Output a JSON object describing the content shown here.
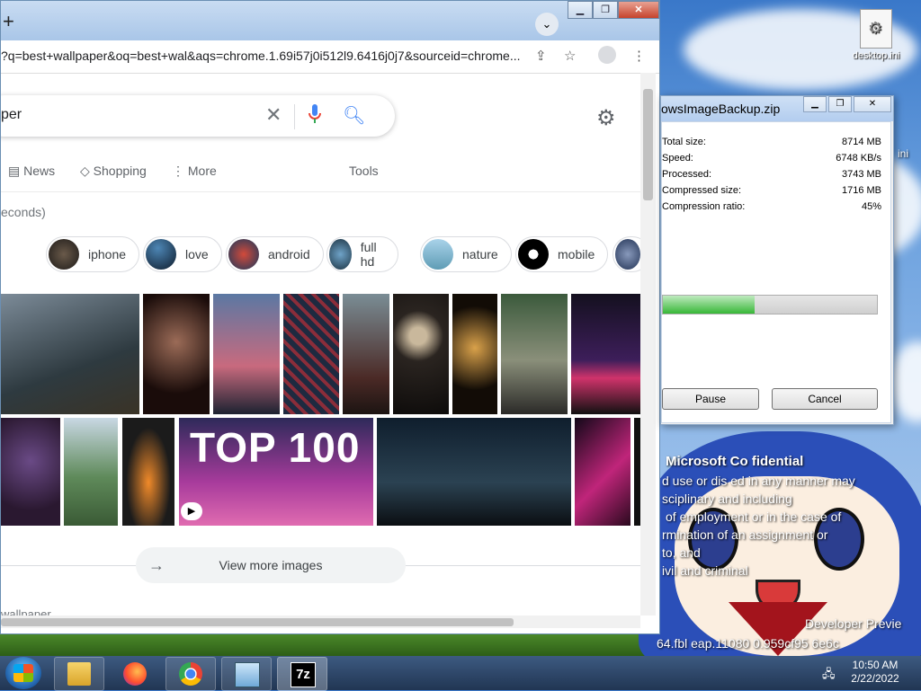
{
  "browser": {
    "url": "?q=best+wallpaper&oq=best+wal&aqs=chrome.1.69i57j0i512l9.6416j0j7&sourceid=chrome...",
    "search_query": "per",
    "tabs": [
      "News",
      "Shopping",
      "More",
      "Tools"
    ],
    "stats": "econds)",
    "chips": [
      "iphone",
      "love",
      "android",
      "full hd",
      "nature",
      "mobile"
    ],
    "view_more": "View more images",
    "footer": "wallpaper"
  },
  "archive_dialog": {
    "title": "owsImageBackup.zip",
    "stats": [
      {
        "label": "Total size:",
        "value": "8714 MB"
      },
      {
        "label": "Speed:",
        "value": "6748 KB/s"
      },
      {
        "label": "Processed:",
        "value": "3743 MB"
      },
      {
        "label": "Compressed size:",
        "value": "1716 MB"
      },
      {
        "label": "Compression ratio:",
        "value": "45%"
      }
    ],
    "progress_fraction": 0.43,
    "pause_label": "Pause",
    "cancel_label": "Cancel"
  },
  "desktop": {
    "icon_label": "desktop.ini",
    "wallpaper_text": {
      "heading": "Microsoft Co   fidential",
      "line1": "d use or dis   ed in any manner may",
      "line2": "sciplinary        and including",
      "line3": "of employment or in the case of",
      "line4": "rmination of an assignment or",
      "line5": "                              to,   and",
      "line6": "ivil and criminal        ",
      "watermark1": "Developer Previe",
      "watermark2": "64.fbl      eap.11080      0.959cf95      6e6c",
      "side": "ini"
    }
  },
  "taskbar": {
    "time": "10:50 AM",
    "date": "2/22/2022",
    "sevenzip_label": "7z"
  }
}
